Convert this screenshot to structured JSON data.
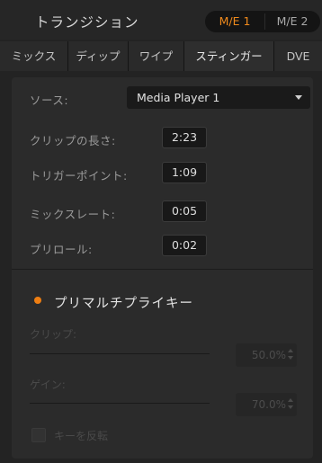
{
  "header": {
    "title": "トランジション",
    "me_buttons": [
      "M/E 1",
      "M/E 2"
    ]
  },
  "tabs": [
    "ミックス",
    "ディップ",
    "ワイプ",
    "スティンガー",
    "DVE"
  ],
  "active_tab": "スティンガー",
  "stinger": {
    "source_label": "ソース:",
    "source_value": "Media Player 1",
    "clip_length_label": "クリップの長さ:",
    "clip_length_value": "2:23",
    "trigger_point_label": "トリガーポイント:",
    "trigger_point_value": "1:09",
    "mix_rate_label": "ミックスレート:",
    "mix_rate_value": "0:05",
    "preroll_label": "プリロール:",
    "preroll_value": "0:02"
  },
  "premultiplied_key": {
    "label": "プリマルチプライキー",
    "enabled": true,
    "clip_label": "クリップ:",
    "clip_value": "50.0%",
    "gain_label": "ゲイン:",
    "gain_value": "70.0%",
    "invert_label": "キーを反転"
  },
  "colors": {
    "accent": "#f08a1c",
    "panel": "#2b2b2b",
    "background": "#232323"
  }
}
